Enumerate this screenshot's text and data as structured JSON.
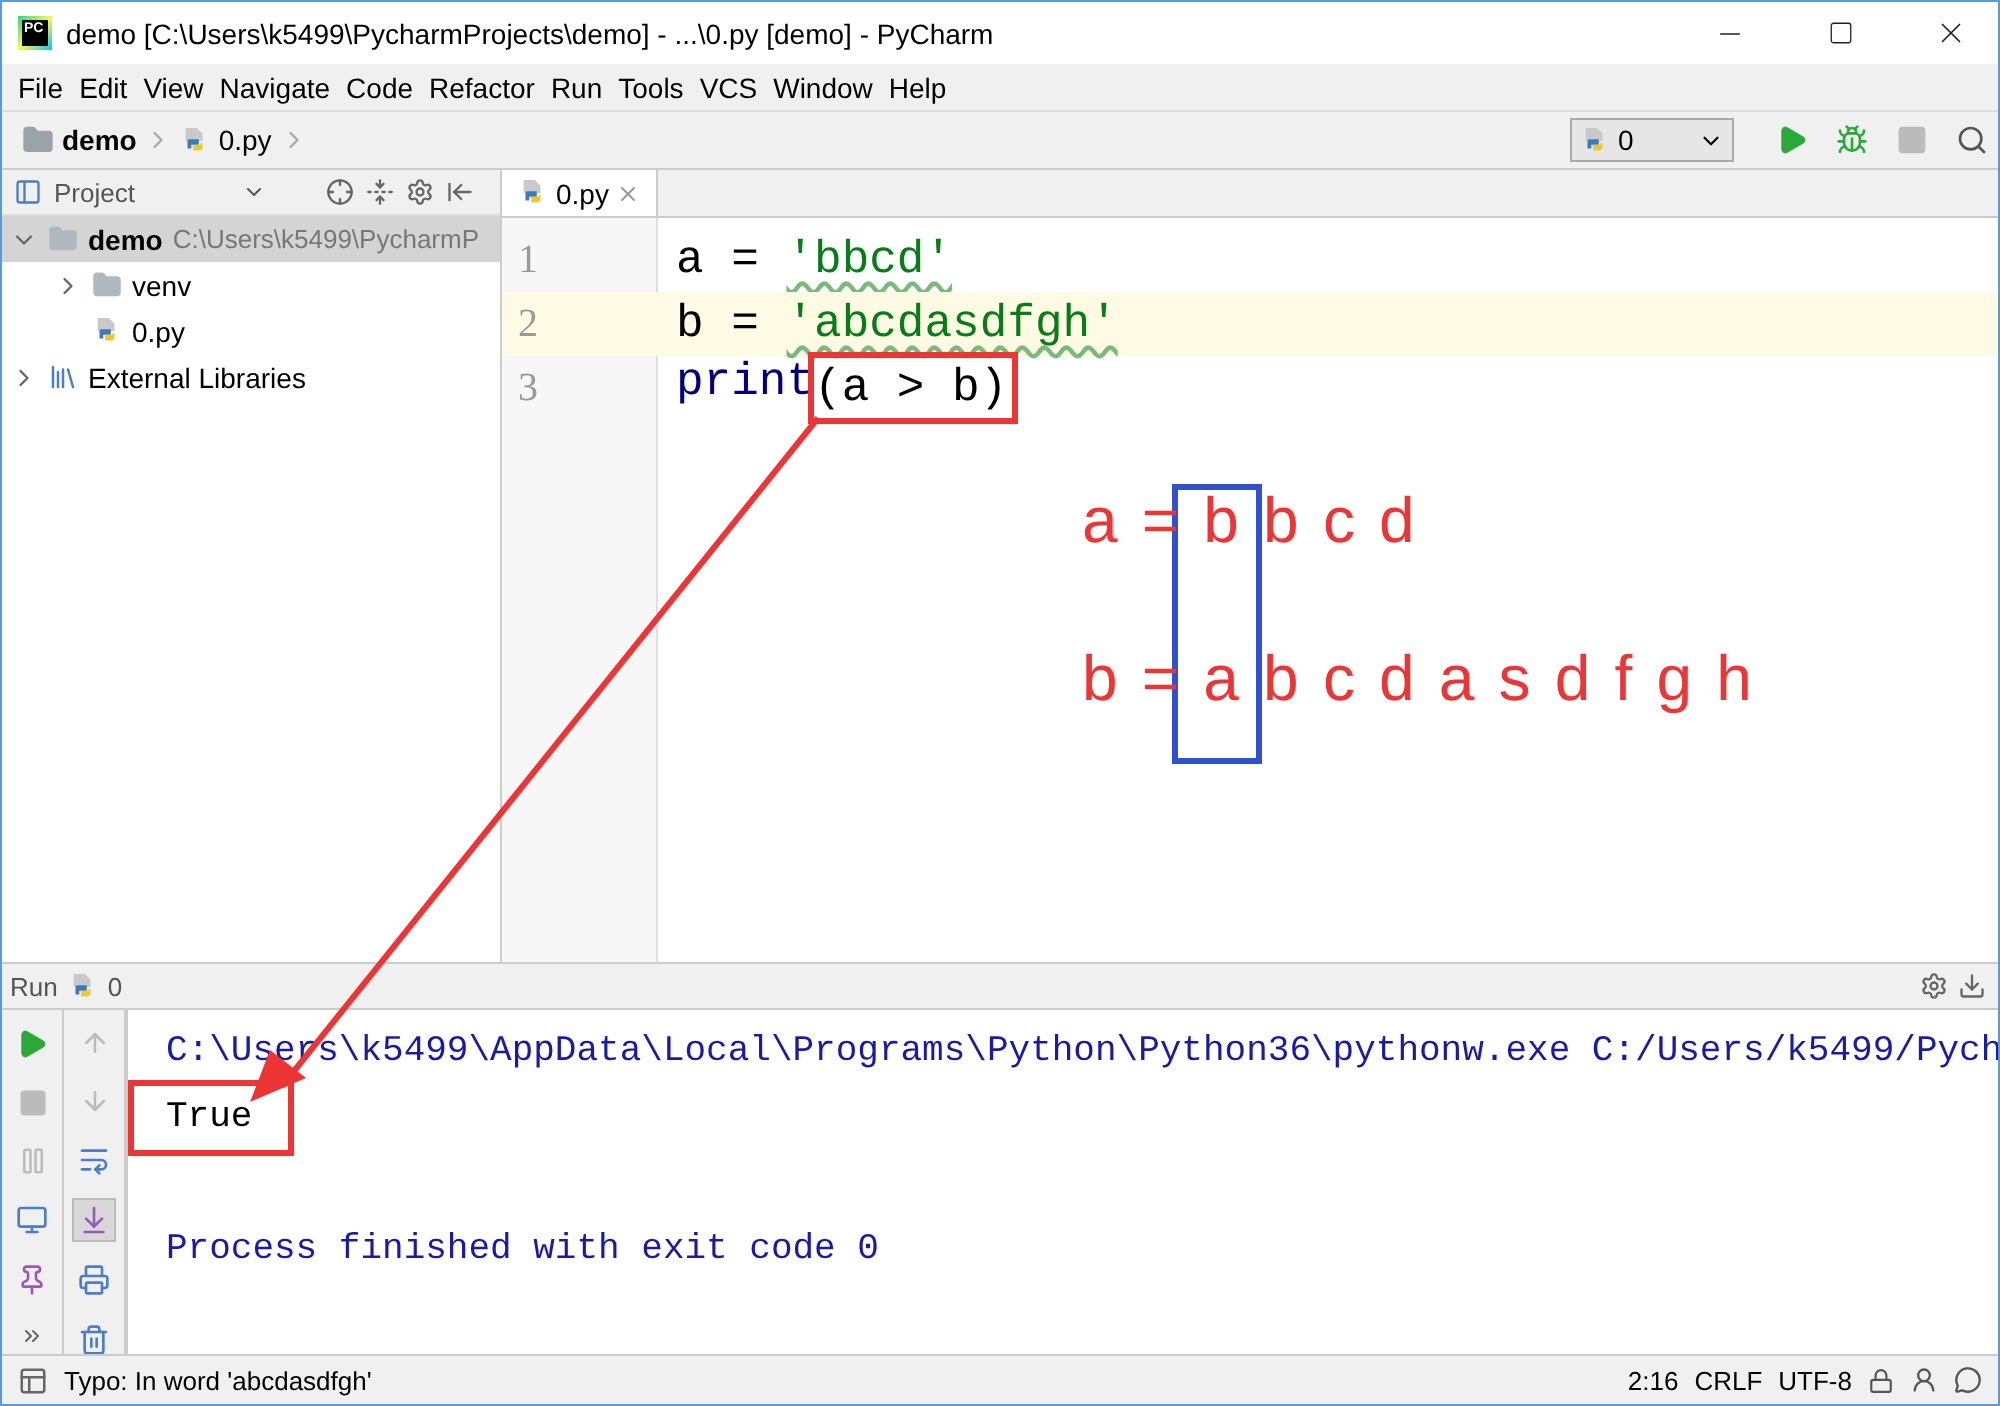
{
  "window": {
    "logo_text": "PC",
    "title": "demo [C:\\Users\\k5499\\PycharmProjects\\demo] - ...\\0.py [demo] - PyCharm"
  },
  "menu": [
    "File",
    "Edit",
    "View",
    "Navigate",
    "Code",
    "Refactor",
    "Run",
    "Tools",
    "VCS",
    "Window",
    "Help"
  ],
  "breadcrumb": [
    {
      "kind": "folder",
      "label": "demo"
    },
    {
      "kind": "file",
      "label": "0.py"
    }
  ],
  "run_config": {
    "label": "0"
  },
  "project_panel": {
    "title": "Project",
    "tree": [
      {
        "kind": "folder",
        "label": "demo",
        "path": "C:\\Users\\k5499\\PycharmP",
        "selected": true,
        "expanded": true,
        "children": [
          {
            "kind": "folder",
            "label": "venv",
            "selected": false,
            "expanded": false
          },
          {
            "kind": "file",
            "label": "0.py",
            "selected": false
          }
        ]
      },
      {
        "kind": "library",
        "label": "External Libraries",
        "selected": false,
        "expanded": false
      }
    ]
  },
  "editor": {
    "tabs": [
      {
        "label": "0.py",
        "selected": true
      }
    ],
    "lines": [
      {
        "number": "1",
        "current": false,
        "tokens": [
          {
            "kind": "plain",
            "text": "a = "
          },
          {
            "kind": "string",
            "text": "'bbcd'",
            "typo": true
          }
        ]
      },
      {
        "number": "2",
        "current": true,
        "tokens": [
          {
            "kind": "plain",
            "text": "b = "
          },
          {
            "kind": "string",
            "text": "'abcdasdfgh'",
            "typo": true
          }
        ]
      },
      {
        "number": "3",
        "current": false,
        "tokens": [
          {
            "kind": "builtin",
            "text": "print"
          },
          {
            "kind": "plain",
            "text": "(a > b)",
            "boxed": true
          }
        ]
      }
    ]
  },
  "annotation": {
    "notes": [
      "a = b b c d",
      "b = a b c d a s d f g h"
    ]
  },
  "run_panel": {
    "title": "Run",
    "config": "0",
    "output": [
      {
        "kind": "command",
        "text": "C:\\Users\\k5499\\AppData\\Local\\Programs\\Python\\Python36\\pythonw.exe C:/Users/k5499/Pych"
      },
      {
        "kind": "result",
        "text": "True",
        "boxed": true
      },
      {
        "kind": "info",
        "text": "Process finished with exit code 0"
      }
    ]
  },
  "status_bar": {
    "message": "Typo: In word 'abcdasdfgh'",
    "position": "2:16",
    "line_separator": "CRLF",
    "encoding": "UTF-8"
  }
}
